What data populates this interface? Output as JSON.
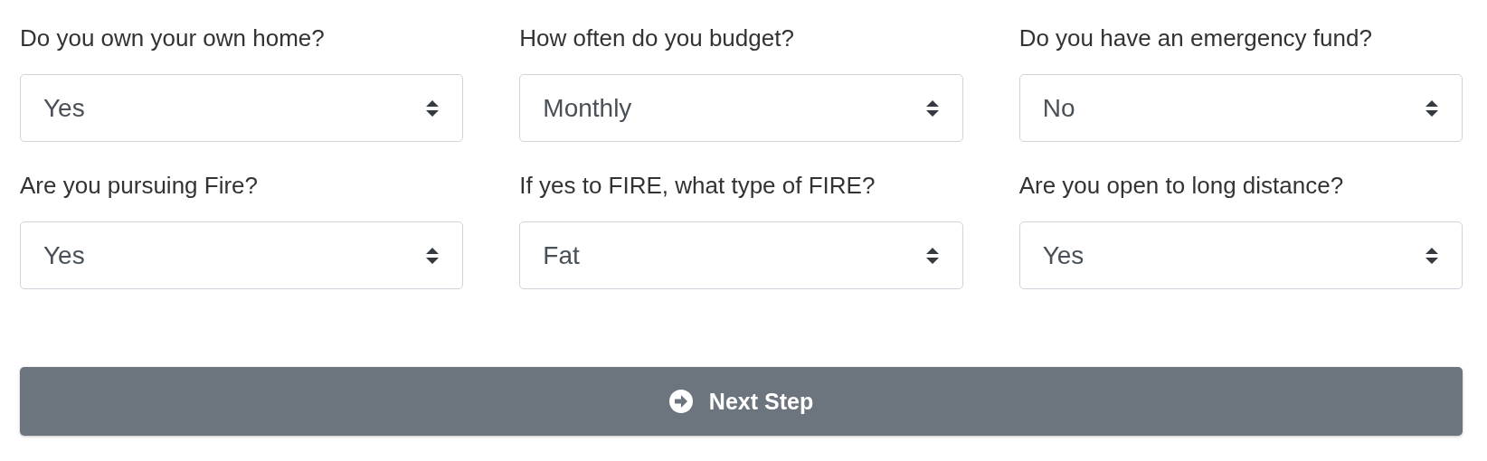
{
  "fields": [
    {
      "label": "Do you own your own home?",
      "value": "Yes"
    },
    {
      "label": "How often do you budget?",
      "value": "Monthly"
    },
    {
      "label": "Do you have an emergency fund?",
      "value": "No"
    },
    {
      "label": "Are you pursuing Fire?",
      "value": "Yes"
    },
    {
      "label": "If yes to FIRE, what type of FIRE?",
      "value": "Fat"
    },
    {
      "label": "Are you open to long distance?",
      "value": "Yes"
    }
  ],
  "button": {
    "label": "Next Step"
  }
}
